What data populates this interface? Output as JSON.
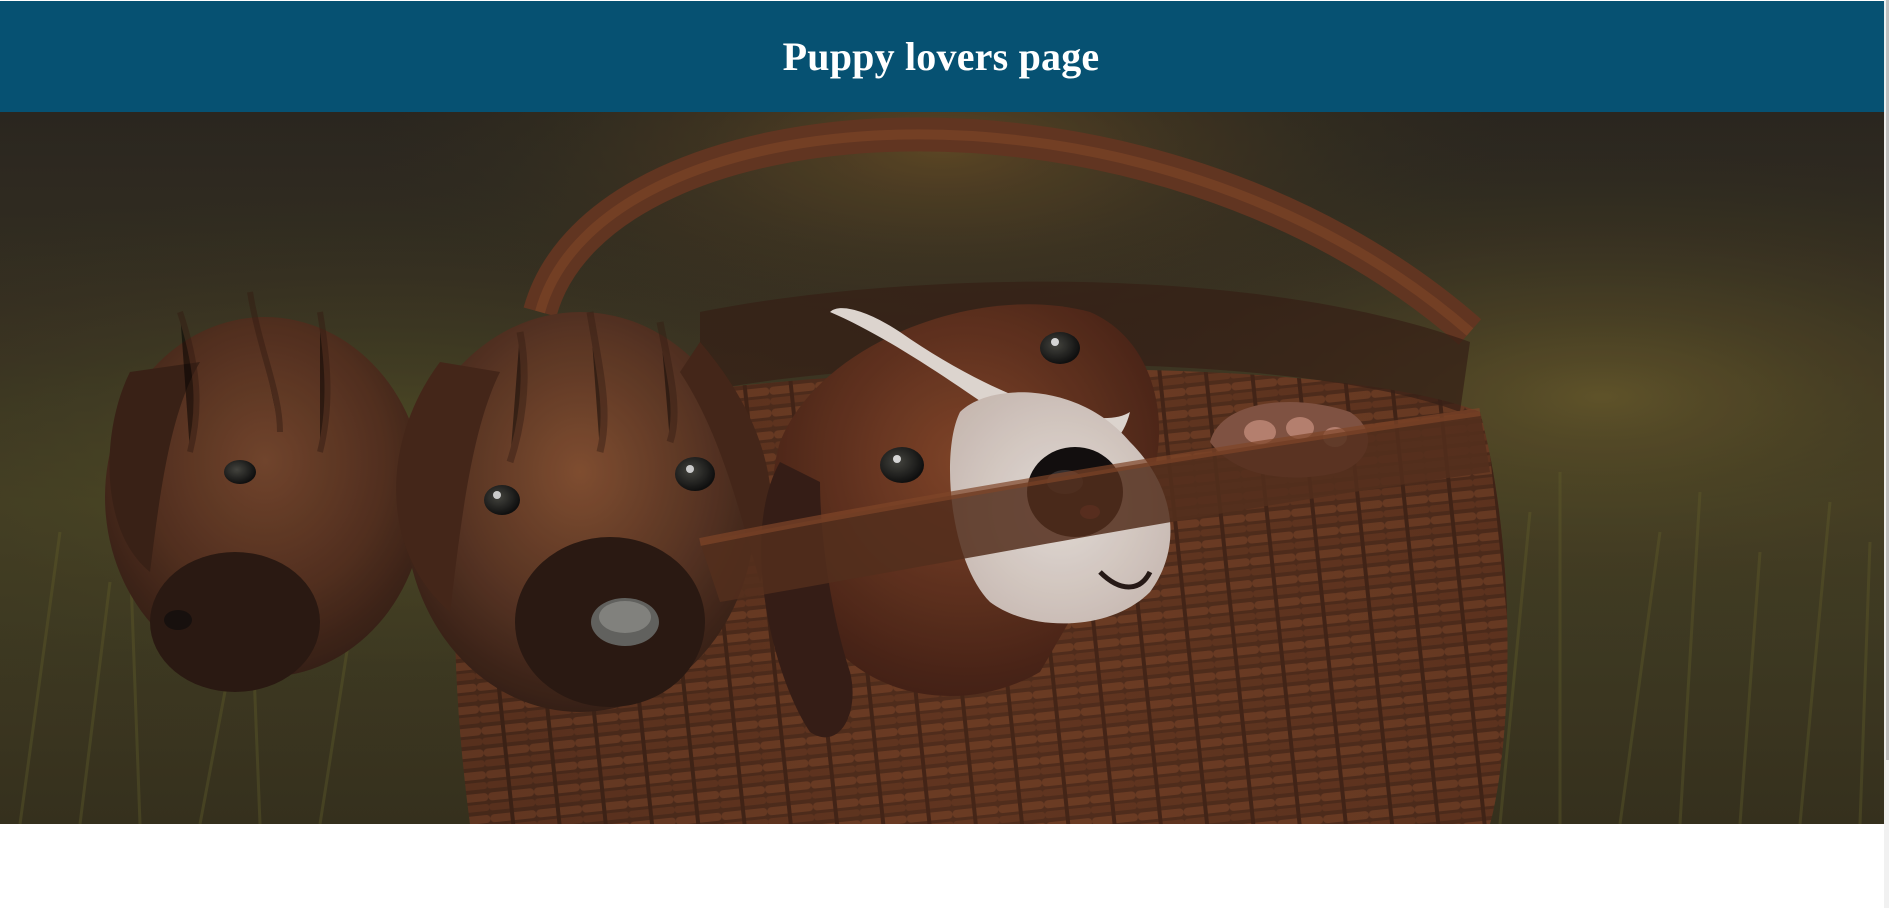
{
  "header": {
    "title": "Puppy lovers page",
    "background_color": "#065172",
    "text_color": "#ffffff"
  },
  "hero": {
    "subject": "three puppies in a wicker basket on grass",
    "icon": "puppies-in-basket-photo"
  },
  "page": {
    "background_color": "#ffffff"
  }
}
